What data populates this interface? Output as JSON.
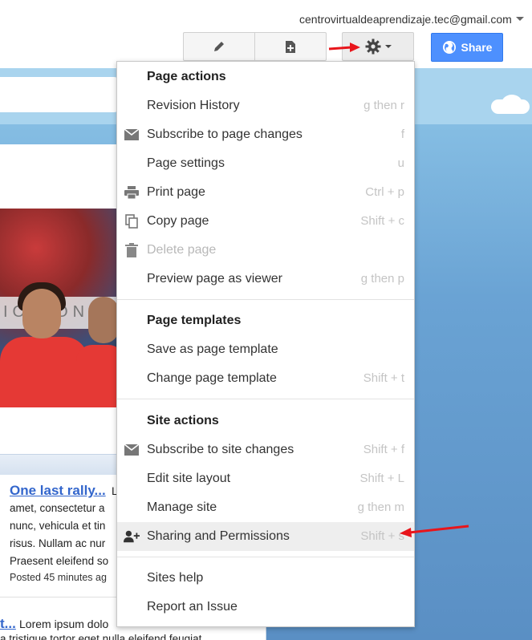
{
  "header": {
    "account_email": "centrovirtualdeaprendizaje.tec@gmail.com",
    "share_label": "Share"
  },
  "icons": {
    "edit": "pencil-icon",
    "new_page": "new-page-icon",
    "more_actions": "gear-icon",
    "share": "globe-icon"
  },
  "colors": {
    "share_button": "#4d90fe",
    "annotation_arrow": "#e8151b",
    "link": "#3366cc"
  },
  "content": {
    "photo_banner_text": "ION ONL",
    "post1": {
      "title": "One last rally...",
      "snippet": "L",
      "lines": [
        "amet, consectetur a",
        "nunc, vehicula et tin",
        "risus. Nullam ac nur",
        "Praesent eleifend so"
      ],
      "meta": "Posted 45 minutes ag"
    },
    "post2": {
      "title": "t...",
      "snippet": "Lorem ipsum dolo",
      "line2": "a tristique tortor eget nulla eleifend feugiat"
    }
  },
  "menu": {
    "page_actions_header": "Page actions",
    "page_templates_header": "Page templates",
    "site_actions_header": "Site actions",
    "items": {
      "revision_history": {
        "label": "Revision History",
        "shortcut": "g then r"
      },
      "subscribe_page": {
        "label": "Subscribe to page changes",
        "shortcut": "f"
      },
      "page_settings": {
        "label": "Page settings",
        "shortcut": "u"
      },
      "print_page": {
        "label": "Print page",
        "shortcut": "Ctrl + p"
      },
      "copy_page": {
        "label": "Copy page",
        "shortcut": "Shift + c"
      },
      "delete_page": {
        "label": "Delete page",
        "shortcut": ""
      },
      "preview_viewer": {
        "label": "Preview page as viewer",
        "shortcut": "g then p"
      },
      "save_template": {
        "label": "Save as page template",
        "shortcut": ""
      },
      "change_template": {
        "label": "Change page template",
        "shortcut": "Shift + t"
      },
      "subscribe_site": {
        "label": "Subscribe to site changes",
        "shortcut": "Shift + f"
      },
      "edit_layout": {
        "label": "Edit site layout",
        "shortcut": "Shift + L"
      },
      "manage_site": {
        "label": "Manage site",
        "shortcut": "g then m"
      },
      "sharing_permissions": {
        "label": "Sharing and Permissions",
        "shortcut": "Shift + s"
      },
      "sites_help": {
        "label": "Sites help",
        "shortcut": ""
      },
      "report_issue": {
        "label": "Report an Issue",
        "shortcut": ""
      }
    }
  }
}
